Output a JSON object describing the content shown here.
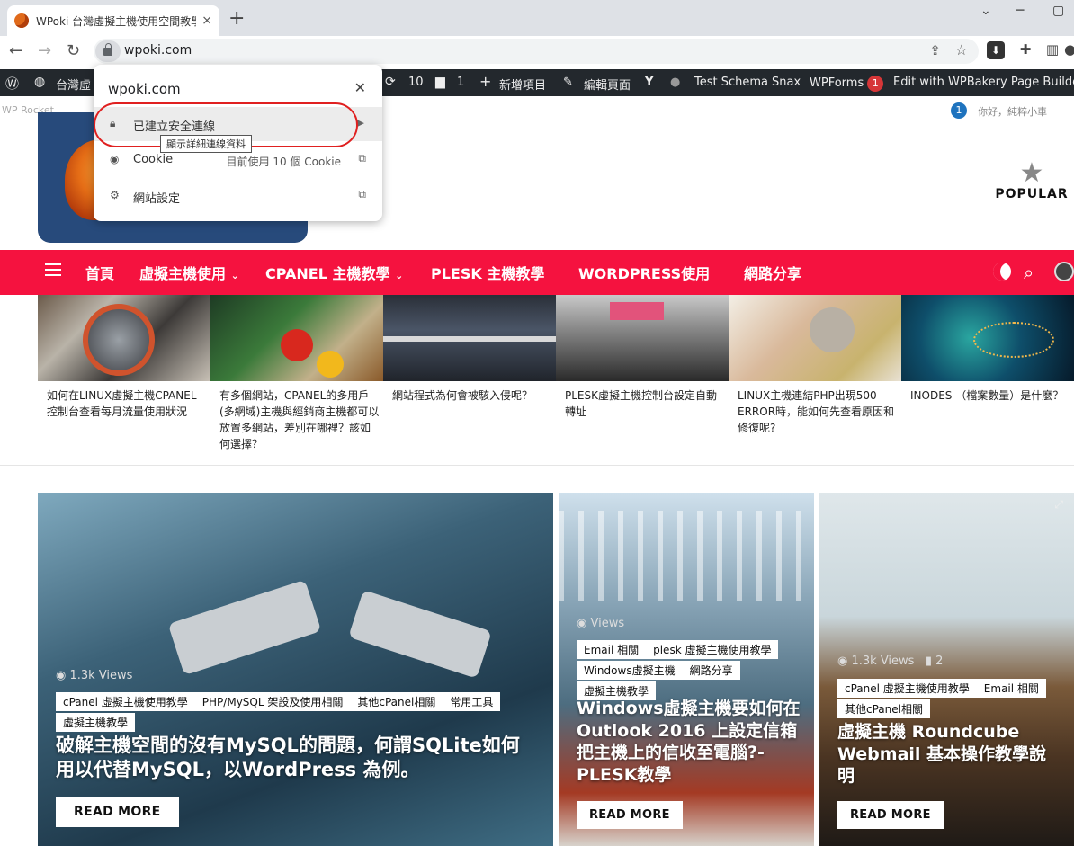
{
  "browser": {
    "tab_title": "WPoki 台灣虛擬主機使用空間教學",
    "tab_close": "×",
    "new_tab": "+",
    "url": "wpoki.com"
  },
  "admin_bar": {
    "site_name": "台灣虛",
    "updates_count": "10",
    "comments_count": "1",
    "new_item": "新增項目",
    "edit_page": "編輯頁面",
    "test_schema": "Test Schema",
    "snax": "Snax",
    "wpforms": "WPForms",
    "wpforms_badge": "1",
    "wpbakery": "Edit with WPBakery Page Builder"
  },
  "sub_bar": {
    "left": "WP Rocket",
    "notif": "1",
    "greeting": "你好，純粹小車"
  },
  "popup": {
    "domain": "wpoki.com",
    "close": "✕",
    "secure_label": "已建立安全連線",
    "tooltip": "顯示詳細連線資料",
    "cookie_label": "Cookie",
    "cookie_detail": "目前使用 10 個 Cookie",
    "site_settings": "網站設定"
  },
  "header": {
    "popular": "POPULAR"
  },
  "nav": {
    "items": [
      "首頁",
      "虛擬主機使用",
      "CPANEL 主機教學",
      "PLESK 主機教學",
      "WORDPRESS使用",
      "網路分享"
    ]
  },
  "thumbs": [
    "如何在LINUX虛擬主機CPANEL控制台查看每月流量使用狀況",
    "有多個網站，CPANEL的多用戶(多網域)主機與經銷商主機都可以放置多網站，差別在哪裡？該如何選擇？",
    "網站程式為何會被駭入侵呢？",
    "PLESK虛擬主機控制台設定自動轉址",
    "LINUX主機連結PHP出現500 ERROR時，能如何先查看原因和修復呢?",
    "INODES （檔案數量）是什麼？"
  ],
  "cards": [
    {
      "views": "1.3k Views",
      "tags": [
        "cPanel 虛擬主機使用教學",
        "PHP/MySQL 架設及使用相關",
        "其他cPanel相關",
        "常用工具",
        "虛擬主機教學"
      ],
      "title": "破解主機空間的沒有MySQL的問題，何謂SQLite如何用以代替MySQL，以WordPress 為例。",
      "button": "READ MORE"
    },
    {
      "views": "Views",
      "tags": [
        "Email 相關",
        "plesk 虛擬主機使用教學",
        "Windows虛擬主機",
        "網路分享",
        "虛擬主機教學"
      ],
      "title": "Windows虛擬主機要如何在 Outlook 2016 上設定信箱把主機上的信收至電腦?-PLESK教學",
      "button": "READ MORE"
    },
    {
      "views": "1.3k Views",
      "comments": "2",
      "tags": [
        "cPanel 虛擬主機使用教學",
        "Email 相關",
        "其他cPanel相關"
      ],
      "title": "虛擬主機 Roundcube Webmail 基本操作教學說明",
      "button": "READ MORE"
    }
  ]
}
